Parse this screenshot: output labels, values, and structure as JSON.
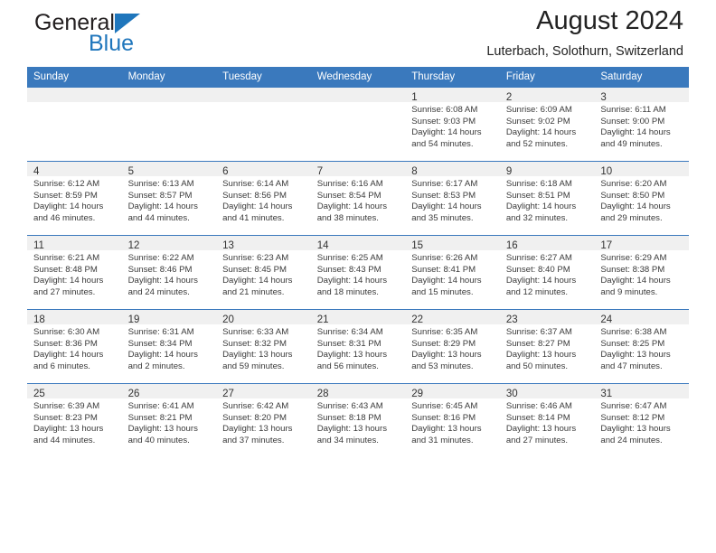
{
  "brand": {
    "name_part1": "General",
    "name_part2": "Blue"
  },
  "header": {
    "title": "August 2024",
    "subtitle": "Luterbach, Solothurn, Switzerland"
  },
  "colors": {
    "header_blue": "#3a79bd",
    "brand_blue": "#1f76bc",
    "date_strip": "#f0f0f0",
    "text": "#333333"
  },
  "weekdays": [
    "Sunday",
    "Monday",
    "Tuesday",
    "Wednesday",
    "Thursday",
    "Friday",
    "Saturday"
  ],
  "labels": {
    "sunrise_prefix": "Sunrise:",
    "sunset_prefix": "Sunset:",
    "daylight_prefix": "Daylight:"
  },
  "weeks": [
    [
      {
        "empty": true
      },
      {
        "empty": true
      },
      {
        "empty": true
      },
      {
        "empty": true
      },
      {
        "day": "1",
        "sunrise": "Sunrise: 6:08 AM",
        "sunset": "Sunset: 9:03 PM",
        "daylight1": "Daylight: 14 hours",
        "daylight2": "and 54 minutes."
      },
      {
        "day": "2",
        "sunrise": "Sunrise: 6:09 AM",
        "sunset": "Sunset: 9:02 PM",
        "daylight1": "Daylight: 14 hours",
        "daylight2": "and 52 minutes."
      },
      {
        "day": "3",
        "sunrise": "Sunrise: 6:11 AM",
        "sunset": "Sunset: 9:00 PM",
        "daylight1": "Daylight: 14 hours",
        "daylight2": "and 49 minutes."
      }
    ],
    [
      {
        "day": "4",
        "sunrise": "Sunrise: 6:12 AM",
        "sunset": "Sunset: 8:59 PM",
        "daylight1": "Daylight: 14 hours",
        "daylight2": "and 46 minutes."
      },
      {
        "day": "5",
        "sunrise": "Sunrise: 6:13 AM",
        "sunset": "Sunset: 8:57 PM",
        "daylight1": "Daylight: 14 hours",
        "daylight2": "and 44 minutes."
      },
      {
        "day": "6",
        "sunrise": "Sunrise: 6:14 AM",
        "sunset": "Sunset: 8:56 PM",
        "daylight1": "Daylight: 14 hours",
        "daylight2": "and 41 minutes."
      },
      {
        "day": "7",
        "sunrise": "Sunrise: 6:16 AM",
        "sunset": "Sunset: 8:54 PM",
        "daylight1": "Daylight: 14 hours",
        "daylight2": "and 38 minutes."
      },
      {
        "day": "8",
        "sunrise": "Sunrise: 6:17 AM",
        "sunset": "Sunset: 8:53 PM",
        "daylight1": "Daylight: 14 hours",
        "daylight2": "and 35 minutes."
      },
      {
        "day": "9",
        "sunrise": "Sunrise: 6:18 AM",
        "sunset": "Sunset: 8:51 PM",
        "daylight1": "Daylight: 14 hours",
        "daylight2": "and 32 minutes."
      },
      {
        "day": "10",
        "sunrise": "Sunrise: 6:20 AM",
        "sunset": "Sunset: 8:50 PM",
        "daylight1": "Daylight: 14 hours",
        "daylight2": "and 29 minutes."
      }
    ],
    [
      {
        "day": "11",
        "sunrise": "Sunrise: 6:21 AM",
        "sunset": "Sunset: 8:48 PM",
        "daylight1": "Daylight: 14 hours",
        "daylight2": "and 27 minutes."
      },
      {
        "day": "12",
        "sunrise": "Sunrise: 6:22 AM",
        "sunset": "Sunset: 8:46 PM",
        "daylight1": "Daylight: 14 hours",
        "daylight2": "and 24 minutes."
      },
      {
        "day": "13",
        "sunrise": "Sunrise: 6:23 AM",
        "sunset": "Sunset: 8:45 PM",
        "daylight1": "Daylight: 14 hours",
        "daylight2": "and 21 minutes."
      },
      {
        "day": "14",
        "sunrise": "Sunrise: 6:25 AM",
        "sunset": "Sunset: 8:43 PM",
        "daylight1": "Daylight: 14 hours",
        "daylight2": "and 18 minutes."
      },
      {
        "day": "15",
        "sunrise": "Sunrise: 6:26 AM",
        "sunset": "Sunset: 8:41 PM",
        "daylight1": "Daylight: 14 hours",
        "daylight2": "and 15 minutes."
      },
      {
        "day": "16",
        "sunrise": "Sunrise: 6:27 AM",
        "sunset": "Sunset: 8:40 PM",
        "daylight1": "Daylight: 14 hours",
        "daylight2": "and 12 minutes."
      },
      {
        "day": "17",
        "sunrise": "Sunrise: 6:29 AM",
        "sunset": "Sunset: 8:38 PM",
        "daylight1": "Daylight: 14 hours",
        "daylight2": "and 9 minutes."
      }
    ],
    [
      {
        "day": "18",
        "sunrise": "Sunrise: 6:30 AM",
        "sunset": "Sunset: 8:36 PM",
        "daylight1": "Daylight: 14 hours",
        "daylight2": "and 6 minutes."
      },
      {
        "day": "19",
        "sunrise": "Sunrise: 6:31 AM",
        "sunset": "Sunset: 8:34 PM",
        "daylight1": "Daylight: 14 hours",
        "daylight2": "and 2 minutes."
      },
      {
        "day": "20",
        "sunrise": "Sunrise: 6:33 AM",
        "sunset": "Sunset: 8:32 PM",
        "daylight1": "Daylight: 13 hours",
        "daylight2": "and 59 minutes."
      },
      {
        "day": "21",
        "sunrise": "Sunrise: 6:34 AM",
        "sunset": "Sunset: 8:31 PM",
        "daylight1": "Daylight: 13 hours",
        "daylight2": "and 56 minutes."
      },
      {
        "day": "22",
        "sunrise": "Sunrise: 6:35 AM",
        "sunset": "Sunset: 8:29 PM",
        "daylight1": "Daylight: 13 hours",
        "daylight2": "and 53 minutes."
      },
      {
        "day": "23",
        "sunrise": "Sunrise: 6:37 AM",
        "sunset": "Sunset: 8:27 PM",
        "daylight1": "Daylight: 13 hours",
        "daylight2": "and 50 minutes."
      },
      {
        "day": "24",
        "sunrise": "Sunrise: 6:38 AM",
        "sunset": "Sunset: 8:25 PM",
        "daylight1": "Daylight: 13 hours",
        "daylight2": "and 47 minutes."
      }
    ],
    [
      {
        "day": "25",
        "sunrise": "Sunrise: 6:39 AM",
        "sunset": "Sunset: 8:23 PM",
        "daylight1": "Daylight: 13 hours",
        "daylight2": "and 44 minutes."
      },
      {
        "day": "26",
        "sunrise": "Sunrise: 6:41 AM",
        "sunset": "Sunset: 8:21 PM",
        "daylight1": "Daylight: 13 hours",
        "daylight2": "and 40 minutes."
      },
      {
        "day": "27",
        "sunrise": "Sunrise: 6:42 AM",
        "sunset": "Sunset: 8:20 PM",
        "daylight1": "Daylight: 13 hours",
        "daylight2": "and 37 minutes."
      },
      {
        "day": "28",
        "sunrise": "Sunrise: 6:43 AM",
        "sunset": "Sunset: 8:18 PM",
        "daylight1": "Daylight: 13 hours",
        "daylight2": "and 34 minutes."
      },
      {
        "day": "29",
        "sunrise": "Sunrise: 6:45 AM",
        "sunset": "Sunset: 8:16 PM",
        "daylight1": "Daylight: 13 hours",
        "daylight2": "and 31 minutes."
      },
      {
        "day": "30",
        "sunrise": "Sunrise: 6:46 AM",
        "sunset": "Sunset: 8:14 PM",
        "daylight1": "Daylight: 13 hours",
        "daylight2": "and 27 minutes."
      },
      {
        "day": "31",
        "sunrise": "Sunrise: 6:47 AM",
        "sunset": "Sunset: 8:12 PM",
        "daylight1": "Daylight: 13 hours",
        "daylight2": "and 24 minutes."
      }
    ]
  ]
}
